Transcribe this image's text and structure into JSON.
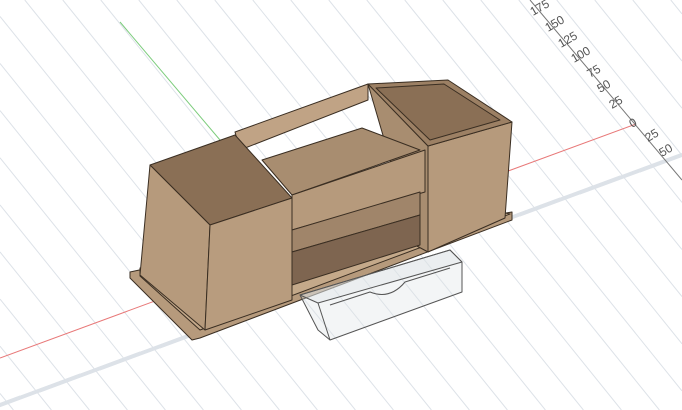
{
  "viewport": {
    "ruler_labels": [
      "175",
      "150",
      "125",
      "100",
      "75",
      "50",
      "25",
      "0",
      "25",
      "50"
    ],
    "colors": {
      "x_axis": "#e87878",
      "y_axis": "#7ccc7c",
      "grid": "#dde2e8",
      "wood": "#b69a7c",
      "wood_dark": "#8f7458",
      "wood_inner": "#a88d70",
      "drawer_outline": "#555555"
    }
  }
}
